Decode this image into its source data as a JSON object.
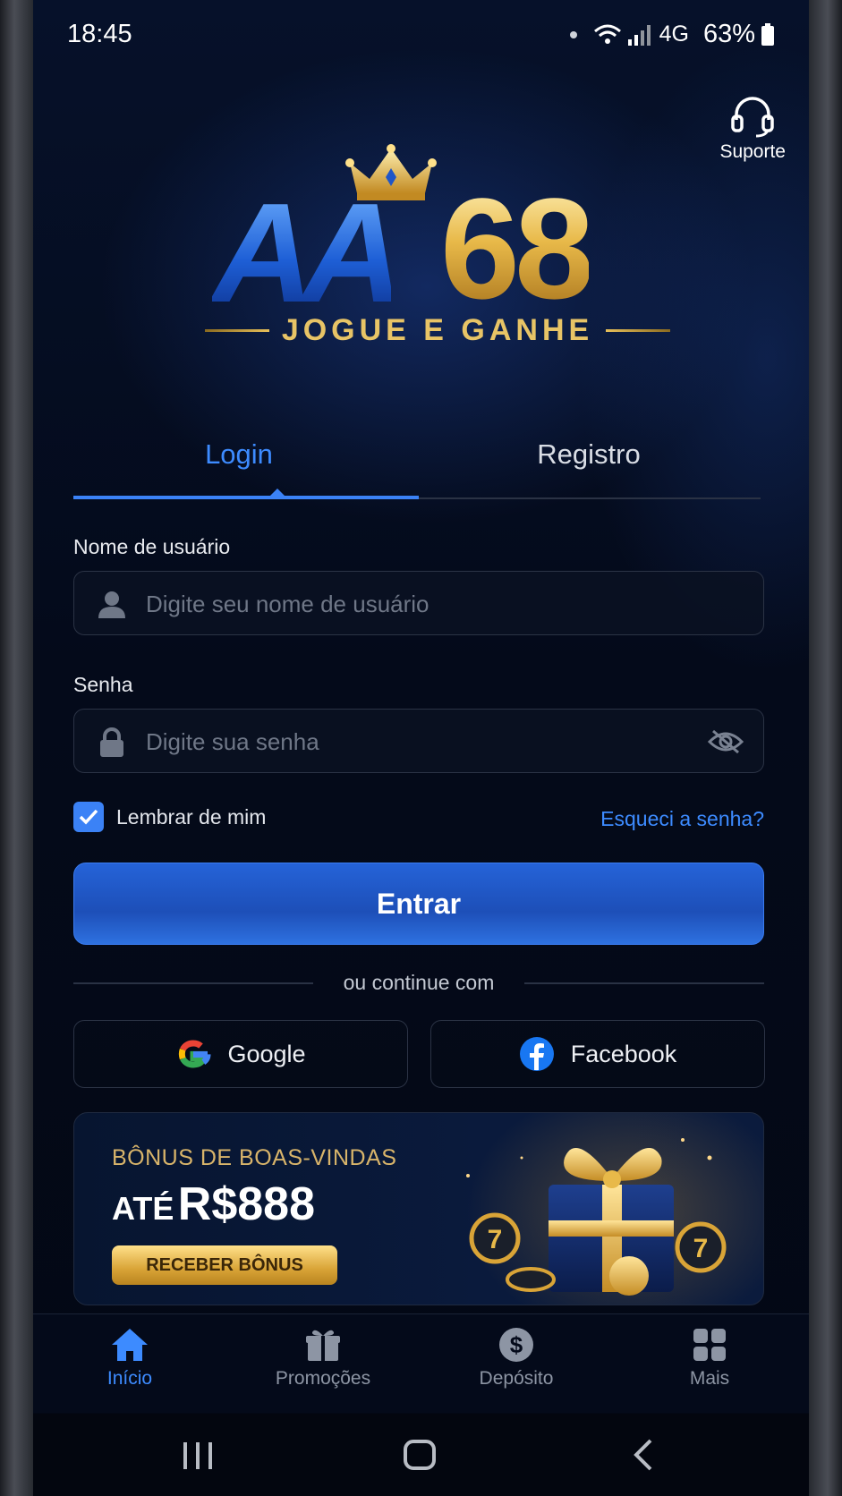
{
  "status_bar": {
    "time": "18:45",
    "network": "4G",
    "battery": "63%"
  },
  "support": {
    "label": "Suporte",
    "icon": "headset-icon"
  },
  "logo": {
    "brand_letters": "AA",
    "brand_number": "68",
    "tagline": "JOGUE E GANHE"
  },
  "tabs": {
    "login": "Login",
    "register": "Registro",
    "active": "login"
  },
  "username": {
    "label": "Nome de usuário",
    "placeholder": "Digite seu nome de usuário",
    "icon": "user-icon"
  },
  "password": {
    "label": "Senha",
    "placeholder": "Digite sua senha",
    "icon": "lock-icon",
    "toggle_icon": "eye-off-icon"
  },
  "remember": {
    "label": "Lembrar de mim",
    "checked": true
  },
  "forgot": {
    "label": "Esqueci a senha?"
  },
  "submit": {
    "label": "Entrar"
  },
  "divider": {
    "label": "ou continue com"
  },
  "social": {
    "google": "Google",
    "facebook": "Facebook"
  },
  "promo": {
    "title": "BÔNUS DE BOAS-VINDAS",
    "prefix": "ATÉ",
    "amount": "R$888",
    "cta": "RECEBER BÔNUS"
  },
  "bottom_nav": [
    {
      "label": "Início",
      "icon": "home-icon",
      "active": true
    },
    {
      "label": "Promoções",
      "icon": "gift-icon",
      "active": false
    },
    {
      "label": "Depósito",
      "icon": "dollar-icon",
      "active": false
    },
    {
      "label": "Mais",
      "icon": "grid-icon",
      "active": false
    }
  ],
  "colors": {
    "accent": "#3b82f6",
    "gold": "#e8c466",
    "background": "#040a1a"
  }
}
